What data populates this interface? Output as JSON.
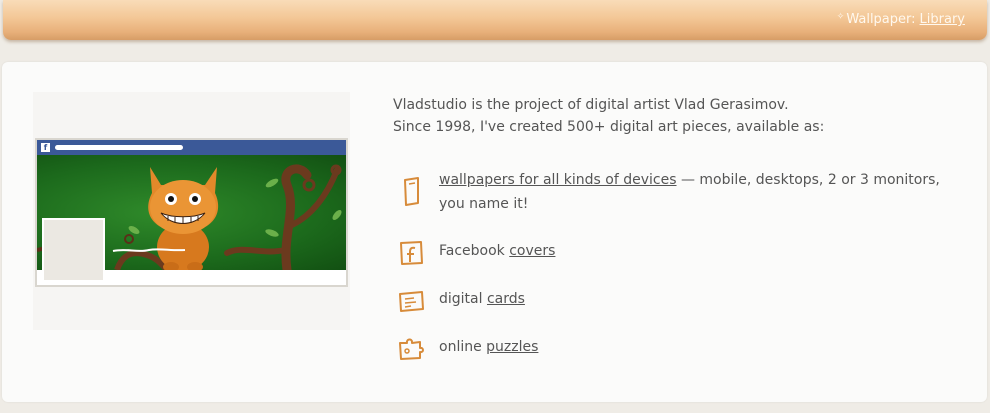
{
  "header": {
    "wallpaper_label": "Wallpaper:",
    "library_link": "Library"
  },
  "intro": {
    "line1": "Vladstudio is the project of digital artist Vlad Gerasimov.",
    "line2": "Since 1998, I've created 500+ digital art pieces, available as:"
  },
  "offerings": [
    {
      "link": "wallpapers for all kinds of devices",
      "suffix": " — mobile, desktops, 2 or 3 monitors,",
      "line2": "you name it!",
      "icon": "device-icon"
    },
    {
      "prefix": "Facebook ",
      "link": "covers",
      "icon": "facebook-icon"
    },
    {
      "prefix": "digital ",
      "link": "cards",
      "icon": "card-icon"
    },
    {
      "prefix": "online ",
      "link": "puzzles",
      "icon": "puzzle-icon"
    }
  ],
  "colors": {
    "accent": "#d78b3a",
    "facebook": "#3b5998",
    "cover_green": "#1c6a1c"
  }
}
